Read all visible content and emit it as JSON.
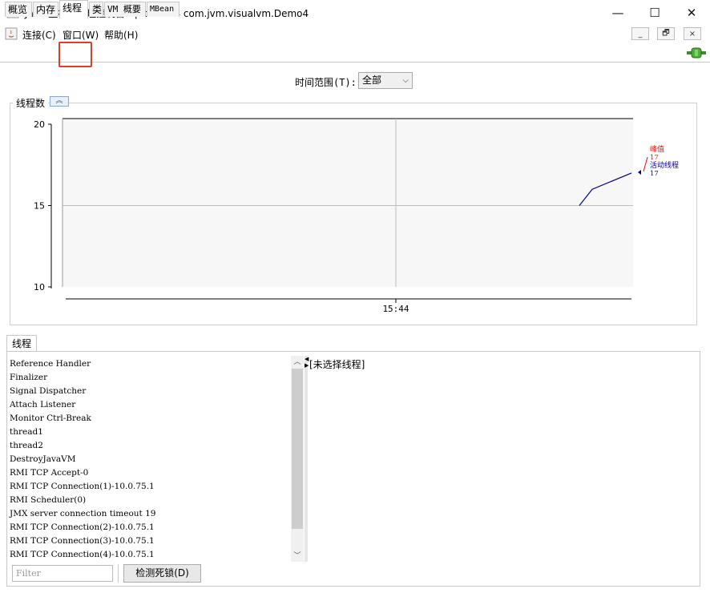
{
  "window": {
    "title": "Java 监视和管理控制台 - pid: 5824 com.jvm.visualvm.Demo4",
    "minimize": "—",
    "maximize": "☐",
    "close": "✕"
  },
  "menu": {
    "connect": "连接(C)",
    "window": "窗口(W)",
    "help": "帮助(H)",
    "mdi_minimize": "_",
    "mdi_restore": "🗗",
    "mdi_close": "×"
  },
  "tabs": [
    {
      "label": "概览"
    },
    {
      "label": "内存"
    },
    {
      "label": "线程"
    },
    {
      "label": "类"
    },
    {
      "label": "VM 概要"
    },
    {
      "label": "MBean"
    }
  ],
  "active_tab": "线程",
  "time_range": {
    "label": "时间范围(T):",
    "value": "全部"
  },
  "thread_count_panel": {
    "title": "线程数"
  },
  "chart_data": {
    "type": "line",
    "ylim": [
      10,
      20
    ],
    "y_ticks": [
      "20",
      "15",
      "10"
    ],
    "x_tick_labels": [
      "15:44"
    ],
    "series": [
      {
        "name": "峰值",
        "current": "17",
        "color": "#ff0000"
      },
      {
        "name": "活动线程",
        "current": "17",
        "color": "#00008b",
        "values": [
          15,
          16,
          17
        ]
      }
    ]
  },
  "threads_section": {
    "tab_label": "线程",
    "threads": [
      "Reference Handler",
      "Finalizer",
      "Signal Dispatcher",
      "Attach Listener",
      "Monitor Ctrl-Break",
      "thread1",
      "thread2",
      "DestroyJavaVM",
      "RMI TCP Accept-0",
      "RMI TCP Connection(1)-10.0.75.1",
      "RMI Scheduler(0)",
      "JMX server connection timeout 19",
      "RMI TCP Connection(2)-10.0.75.1",
      "RMI TCP Connection(3)-10.0.75.1",
      "RMI TCP Connection(4)-10.0.75.1"
    ],
    "detail": "[未选择线程]",
    "filter_placeholder": "Filter",
    "detect_deadlock": "检测死锁(D)"
  }
}
